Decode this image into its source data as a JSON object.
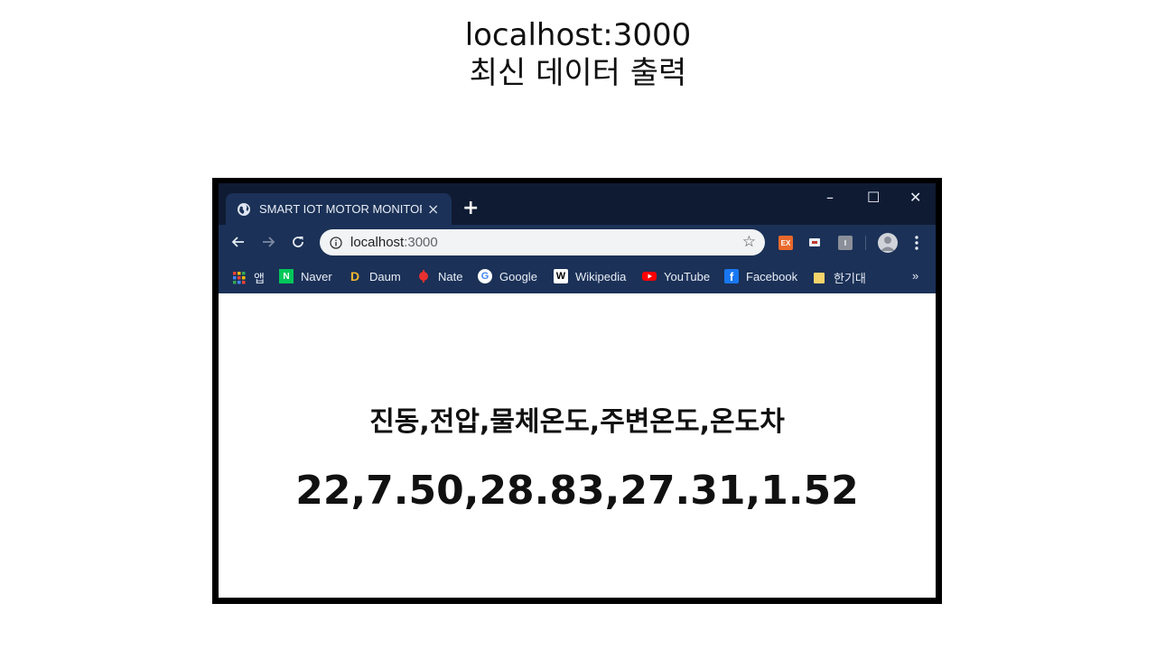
{
  "slide": {
    "title_line1": "localhost:3000",
    "title_line2": "최신 데이터 출력"
  },
  "browser": {
    "tab": {
      "title": "SMART IOT MOTOR MONITORI",
      "icon": "globe-icon",
      "close_label": "×"
    },
    "new_tab_label": "+",
    "window_controls": {
      "minimize": "–",
      "maximize": "☐",
      "close": "✕"
    },
    "address_bar": {
      "host": "localhost",
      "port": ":3000"
    },
    "extensions": {
      "ex_label": "EX",
      "third_label": "I"
    },
    "bookmarks": [
      {
        "label": "앱",
        "icon": "apps-icon"
      },
      {
        "label": "Naver",
        "icon": "naver-icon",
        "icon_text": "N",
        "color": "#03c75a"
      },
      {
        "label": "Daum",
        "icon": "daum-icon",
        "icon_text": "D"
      },
      {
        "label": "Nate",
        "icon": "nate-icon"
      },
      {
        "label": "Google",
        "icon": "google-icon",
        "icon_text": "G"
      },
      {
        "label": "Wikipedia",
        "icon": "wikipedia-icon",
        "icon_text": "W"
      },
      {
        "label": "YouTube",
        "icon": "youtube-icon"
      },
      {
        "label": "Facebook",
        "icon": "facebook-icon",
        "icon_text": "f",
        "color": "#1877f2"
      },
      {
        "label": "한기대",
        "icon": "folder-icon"
      }
    ],
    "more_bookmarks": "»"
  },
  "page": {
    "headers": "진동,전압,물체온도,주변온도,온도차",
    "values": "22,7.50,28.83,27.31,1.52"
  },
  "colors": {
    "titlebar": "#0f1b33",
    "toolbar": "#1b3157",
    "ex_extension": "#e8692c"
  }
}
